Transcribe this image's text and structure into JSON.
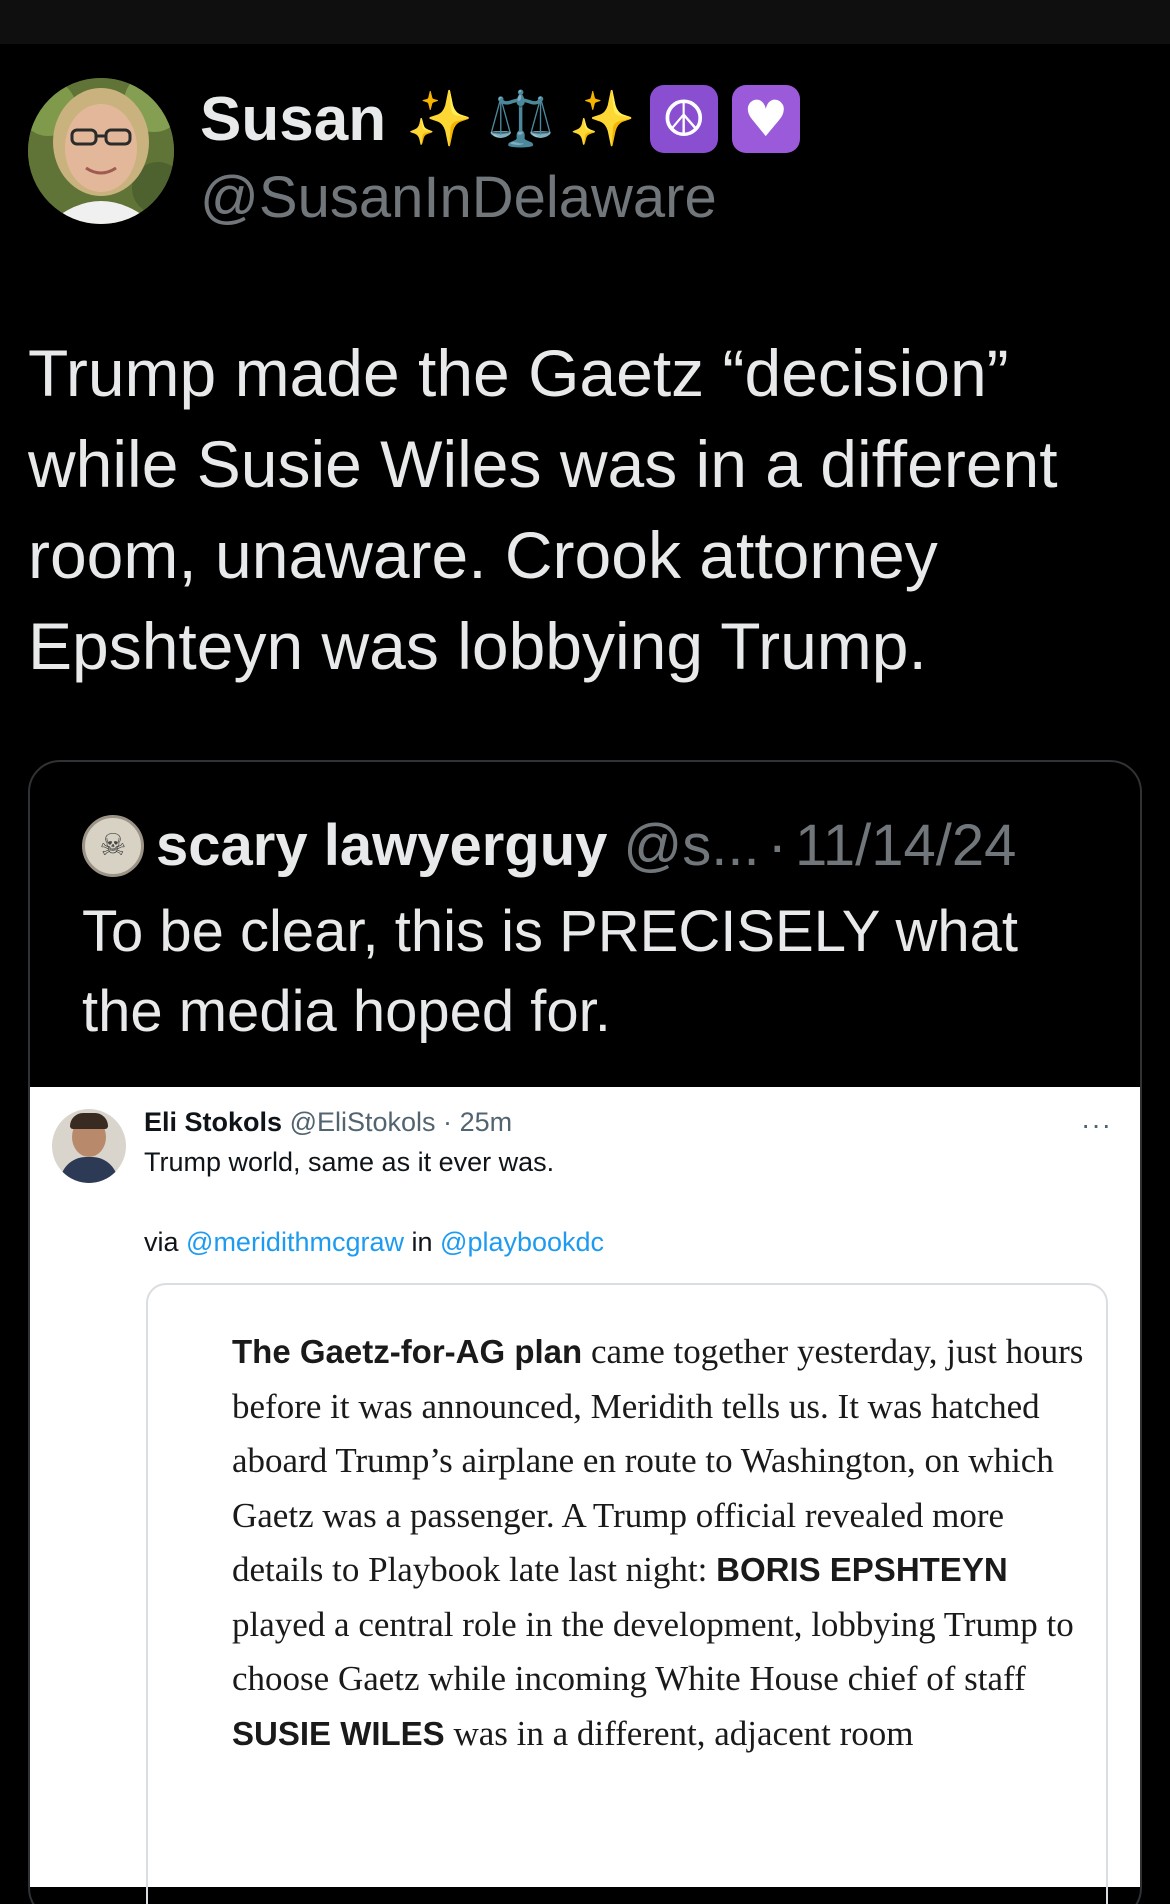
{
  "author": {
    "display_name": "Susan",
    "emojis": [
      "✨",
      "⚖️",
      "✨",
      "☮",
      "♥"
    ],
    "handle": "@SusanInDelaware"
  },
  "tweet": {
    "text": "Trump made the Gaetz “decision” while Susie Wiles was in a different room, unaware. Crook attorney Epshteyn was lobbying Trump."
  },
  "quoted": {
    "name": "scary lawyerguy",
    "handle": "@s...",
    "separator": "·",
    "date": "11/14/24",
    "text": "To be clear, this is PRECISELY what the media hoped for.",
    "screenshot": {
      "name": "Eli Stokols",
      "handle": "@EliStokols",
      "separator": "·",
      "time": "25m",
      "more": "···",
      "line1": "Trump world, same as it ever was.",
      "via": "via",
      "link1": "@meridithmcgraw",
      "in": "in",
      "link2": "@playbookdc",
      "article": {
        "bold1": "The Gaetz-for-AG plan",
        "t1": " came together yesterday, just hours before it was announced, Meridith tells us. It was hatched aboard Trump’s airplane en route to Washington, on which Gaetz was a passenger. A Trump official revealed more details to Playbook late last night: ",
        "bold2": "BORIS EPSHTEYN",
        "t2": " played a central role in the development, lobbying Trump to choose Gaetz while incoming White House chief of staff ",
        "bold3": "SUSIE WILES",
        "t3": " was in a different, adjacent room"
      }
    }
  },
  "colors": {
    "background": "#000000",
    "text": "#e7e9ea",
    "secondary": "#71767b",
    "link": "#1d9bf0"
  }
}
